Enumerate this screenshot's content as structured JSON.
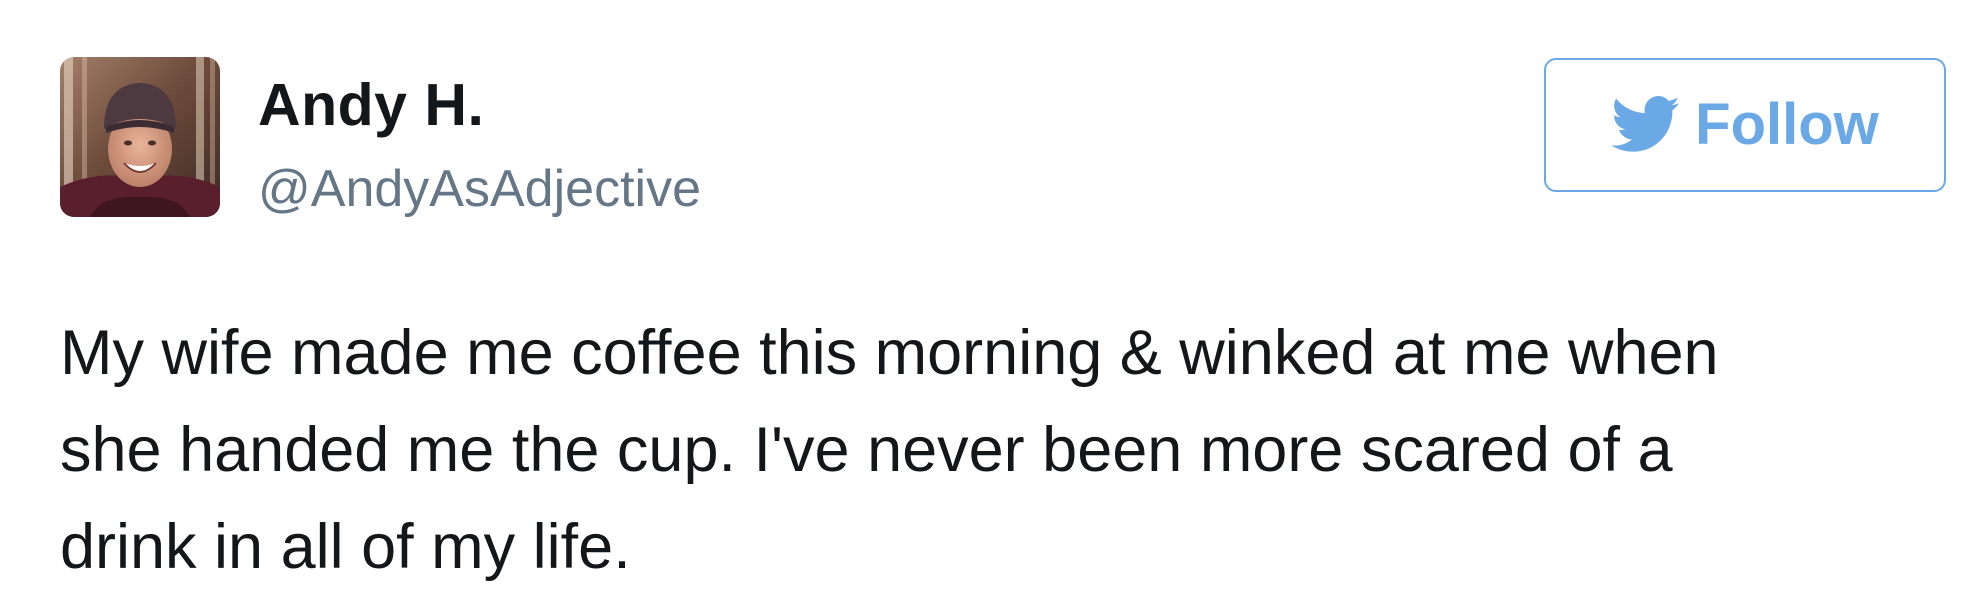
{
  "tweet": {
    "author": {
      "display_name": "Andy H.",
      "handle": "@AndyAsAdjective",
      "avatar_icon": "profile-photo"
    },
    "follow_button": {
      "label": "Follow",
      "icon": "twitter-bird-icon",
      "color": "#6aa8e6"
    },
    "text_lines": [
      "My wife made me coffee this morning & winked at me when",
      "she handed me the cup. I've never been more scared of a",
      "drink in all of my life."
    ]
  }
}
